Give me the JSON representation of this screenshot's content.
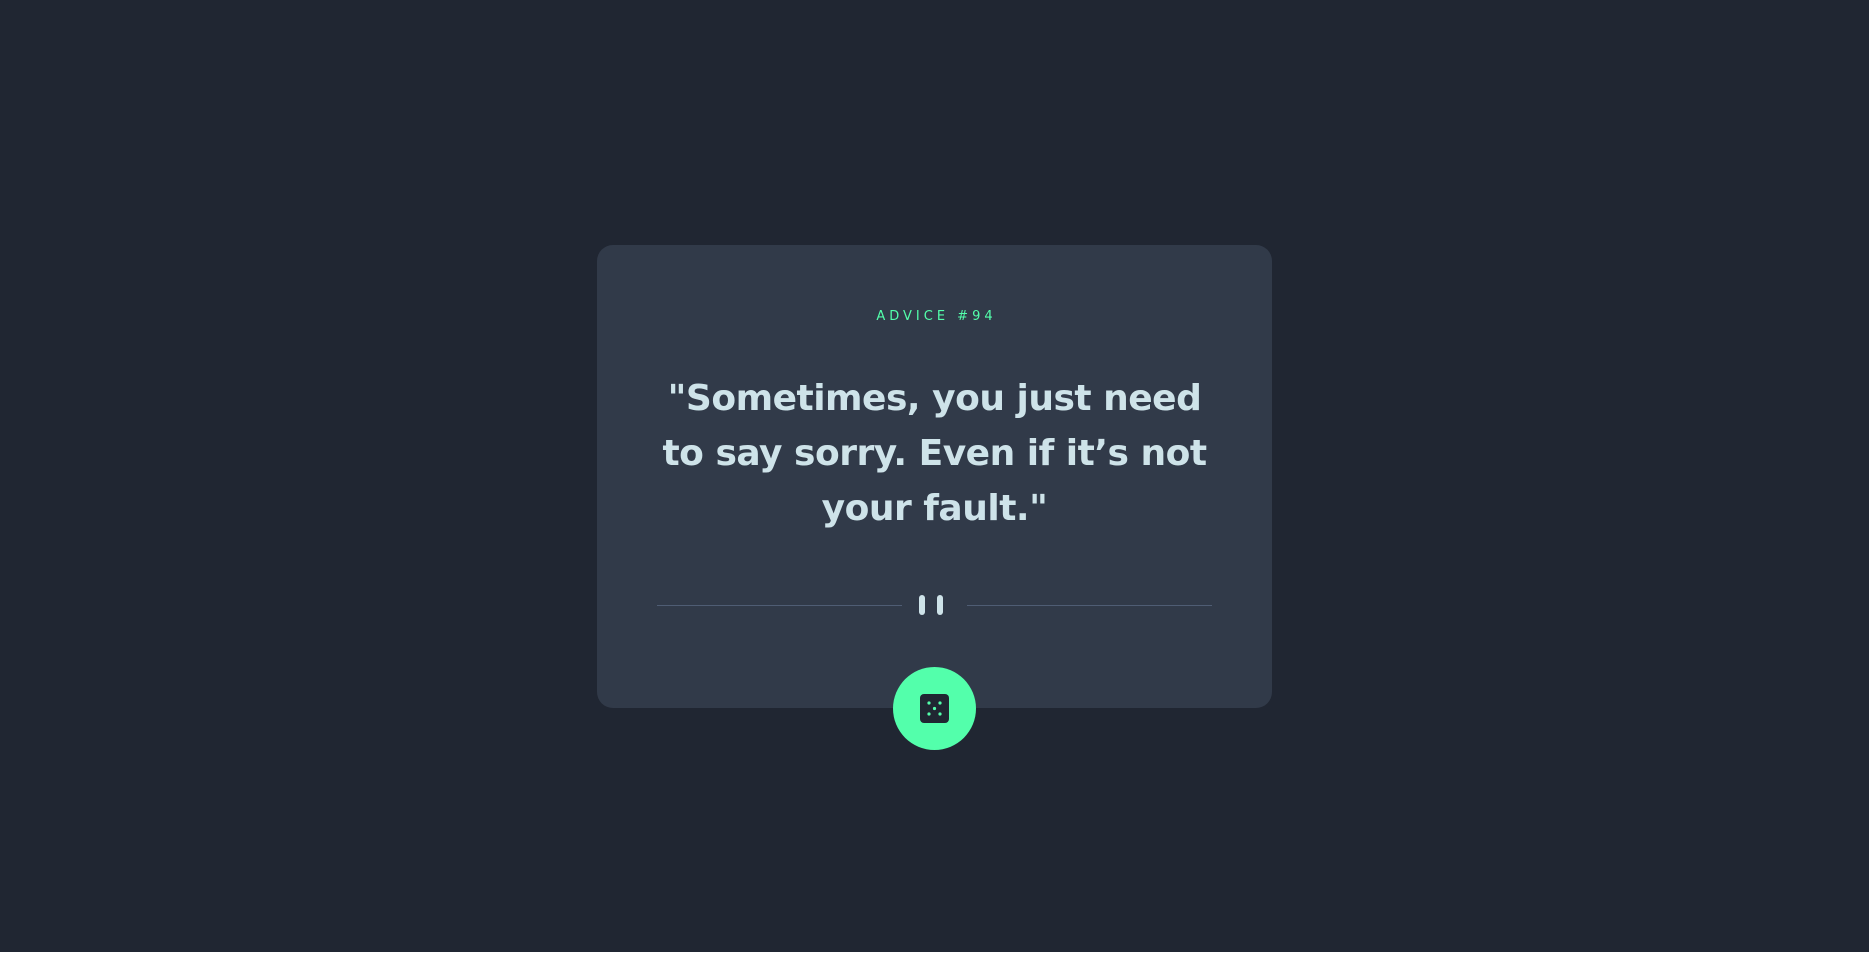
{
  "colors": {
    "page_background": "#202632",
    "card_background": "#313a49",
    "accent": "#53ffab",
    "text": "#cee3e9",
    "divider": "#4f5d74"
  },
  "advice": {
    "id_label": "ADVICE #94",
    "quote": "\"Sometimes, you just need to say sorry. Even if it’s not your fault.\""
  },
  "icons": {
    "divider": "pause-icon",
    "button": "dice-icon"
  }
}
